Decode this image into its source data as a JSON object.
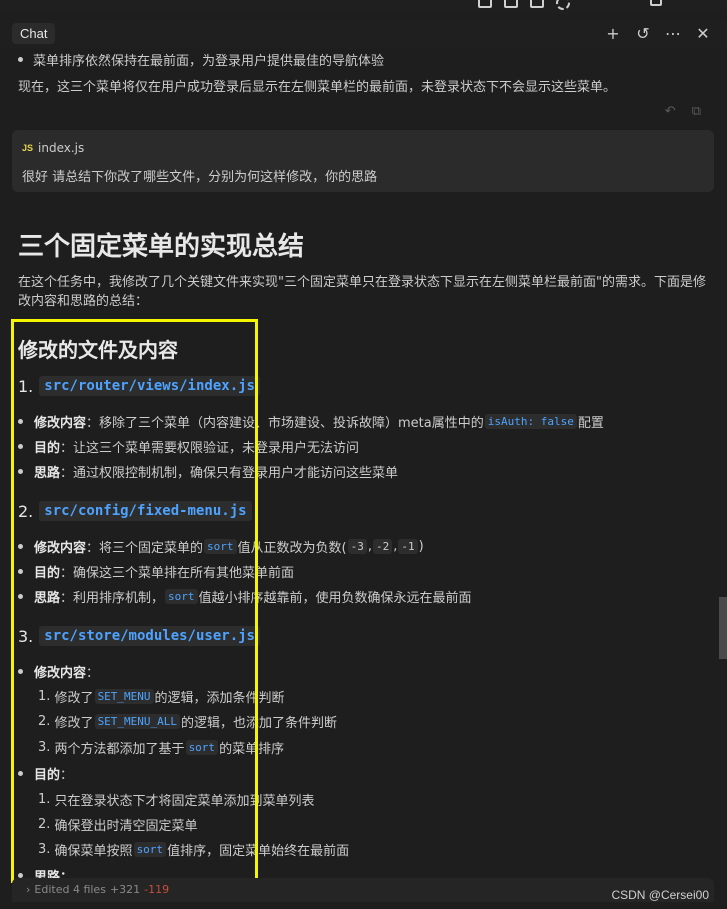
{
  "header": {
    "tab_label": "Chat",
    "icons": [
      "plus-icon",
      "history-icon",
      "more-icon",
      "close-icon"
    ]
  },
  "previous": {
    "bullet_partial": "菜单排序依然保持在最前面，为登录用户提供最佳的导航体验",
    "paragraph": "现在，这三个菜单将仅在用户成功登录后显示在左侧菜单栏的最前面，未登录状态下不会显示这些菜单。"
  },
  "user_message": {
    "file_icon": "JS",
    "file_name": "index.js",
    "text": "很好 请总结下你改了哪些文件，分别为何这样修改，你的思路"
  },
  "response": {
    "title": "三个固定菜单的实现总结",
    "intro": "在这个任务中，我修改了几个关键文件来实现\"三个固定菜单只在登录状态下显示在左侧菜单栏最前面\"的需求。下面是修改内容和思路的总结：",
    "subtitle": "修改的文件及内容",
    "sections": [
      {
        "num": "1.",
        "path": "src/router/views/index.js",
        "items": [
          {
            "label": "修改内容",
            "pre": "：移除了三个菜单（内容建设、市场建设、投诉故障）meta属性中的",
            "code": "isAuth: false",
            "post": "配置"
          },
          {
            "label": "目的",
            "text": "：让这三个菜单需要权限验证，未登录用户无法访问"
          },
          {
            "label": "思路",
            "text": "：通过权限控制机制，确保只有登录用户才能访问这些菜单"
          }
        ]
      },
      {
        "num": "2.",
        "path": "src/config/fixed-menu.js",
        "items": [
          {
            "label": "修改内容",
            "pre": "：将三个固定菜单的",
            "code": "sort",
            "mid": "值从正数改为负数(",
            "c1": "-3",
            "c2": "-2",
            "c3": "-1",
            "post": ")"
          },
          {
            "label": "目的",
            "text": "：确保这三个菜单排在所有其他菜单前面"
          },
          {
            "label": "思路",
            "pre": "：利用排序机制，",
            "code": "sort",
            "post": "值越小排序越靠前，使用负数确保永远在最前面"
          }
        ]
      },
      {
        "num": "3.",
        "path": "src/store/modules/user.js",
        "content_label": "修改内容",
        "content_items": [
          {
            "n": "1.",
            "pre": "修改了",
            "code": "SET_MENU",
            "post": "的逻辑，添加条件判断"
          },
          {
            "n": "2.",
            "pre": "修改了",
            "code": "SET_MENU_ALL",
            "post": "的逻辑，也添加了条件判断"
          },
          {
            "n": "3.",
            "pre": "两个方法都添加了基于",
            "code": "sort",
            "post": "的菜单排序"
          }
        ],
        "purpose_label": "目的",
        "purpose_items": [
          {
            "n": "1.",
            "text": "只在登录状态下才将固定菜单添加到菜单列表"
          },
          {
            "n": "2.",
            "text": "确保登出时清空固定菜单"
          },
          {
            "n": "3.",
            "pre": "确保菜单按照",
            "code": "sort",
            "post": "值排序，固定菜单始终在最前面"
          }
        ],
        "thought_label": "思路："
      }
    ]
  },
  "footer": {
    "edited": "Edited 4 files",
    "added": "+321",
    "removed": "-119",
    "watermark": "CSDN @Cersei00"
  }
}
